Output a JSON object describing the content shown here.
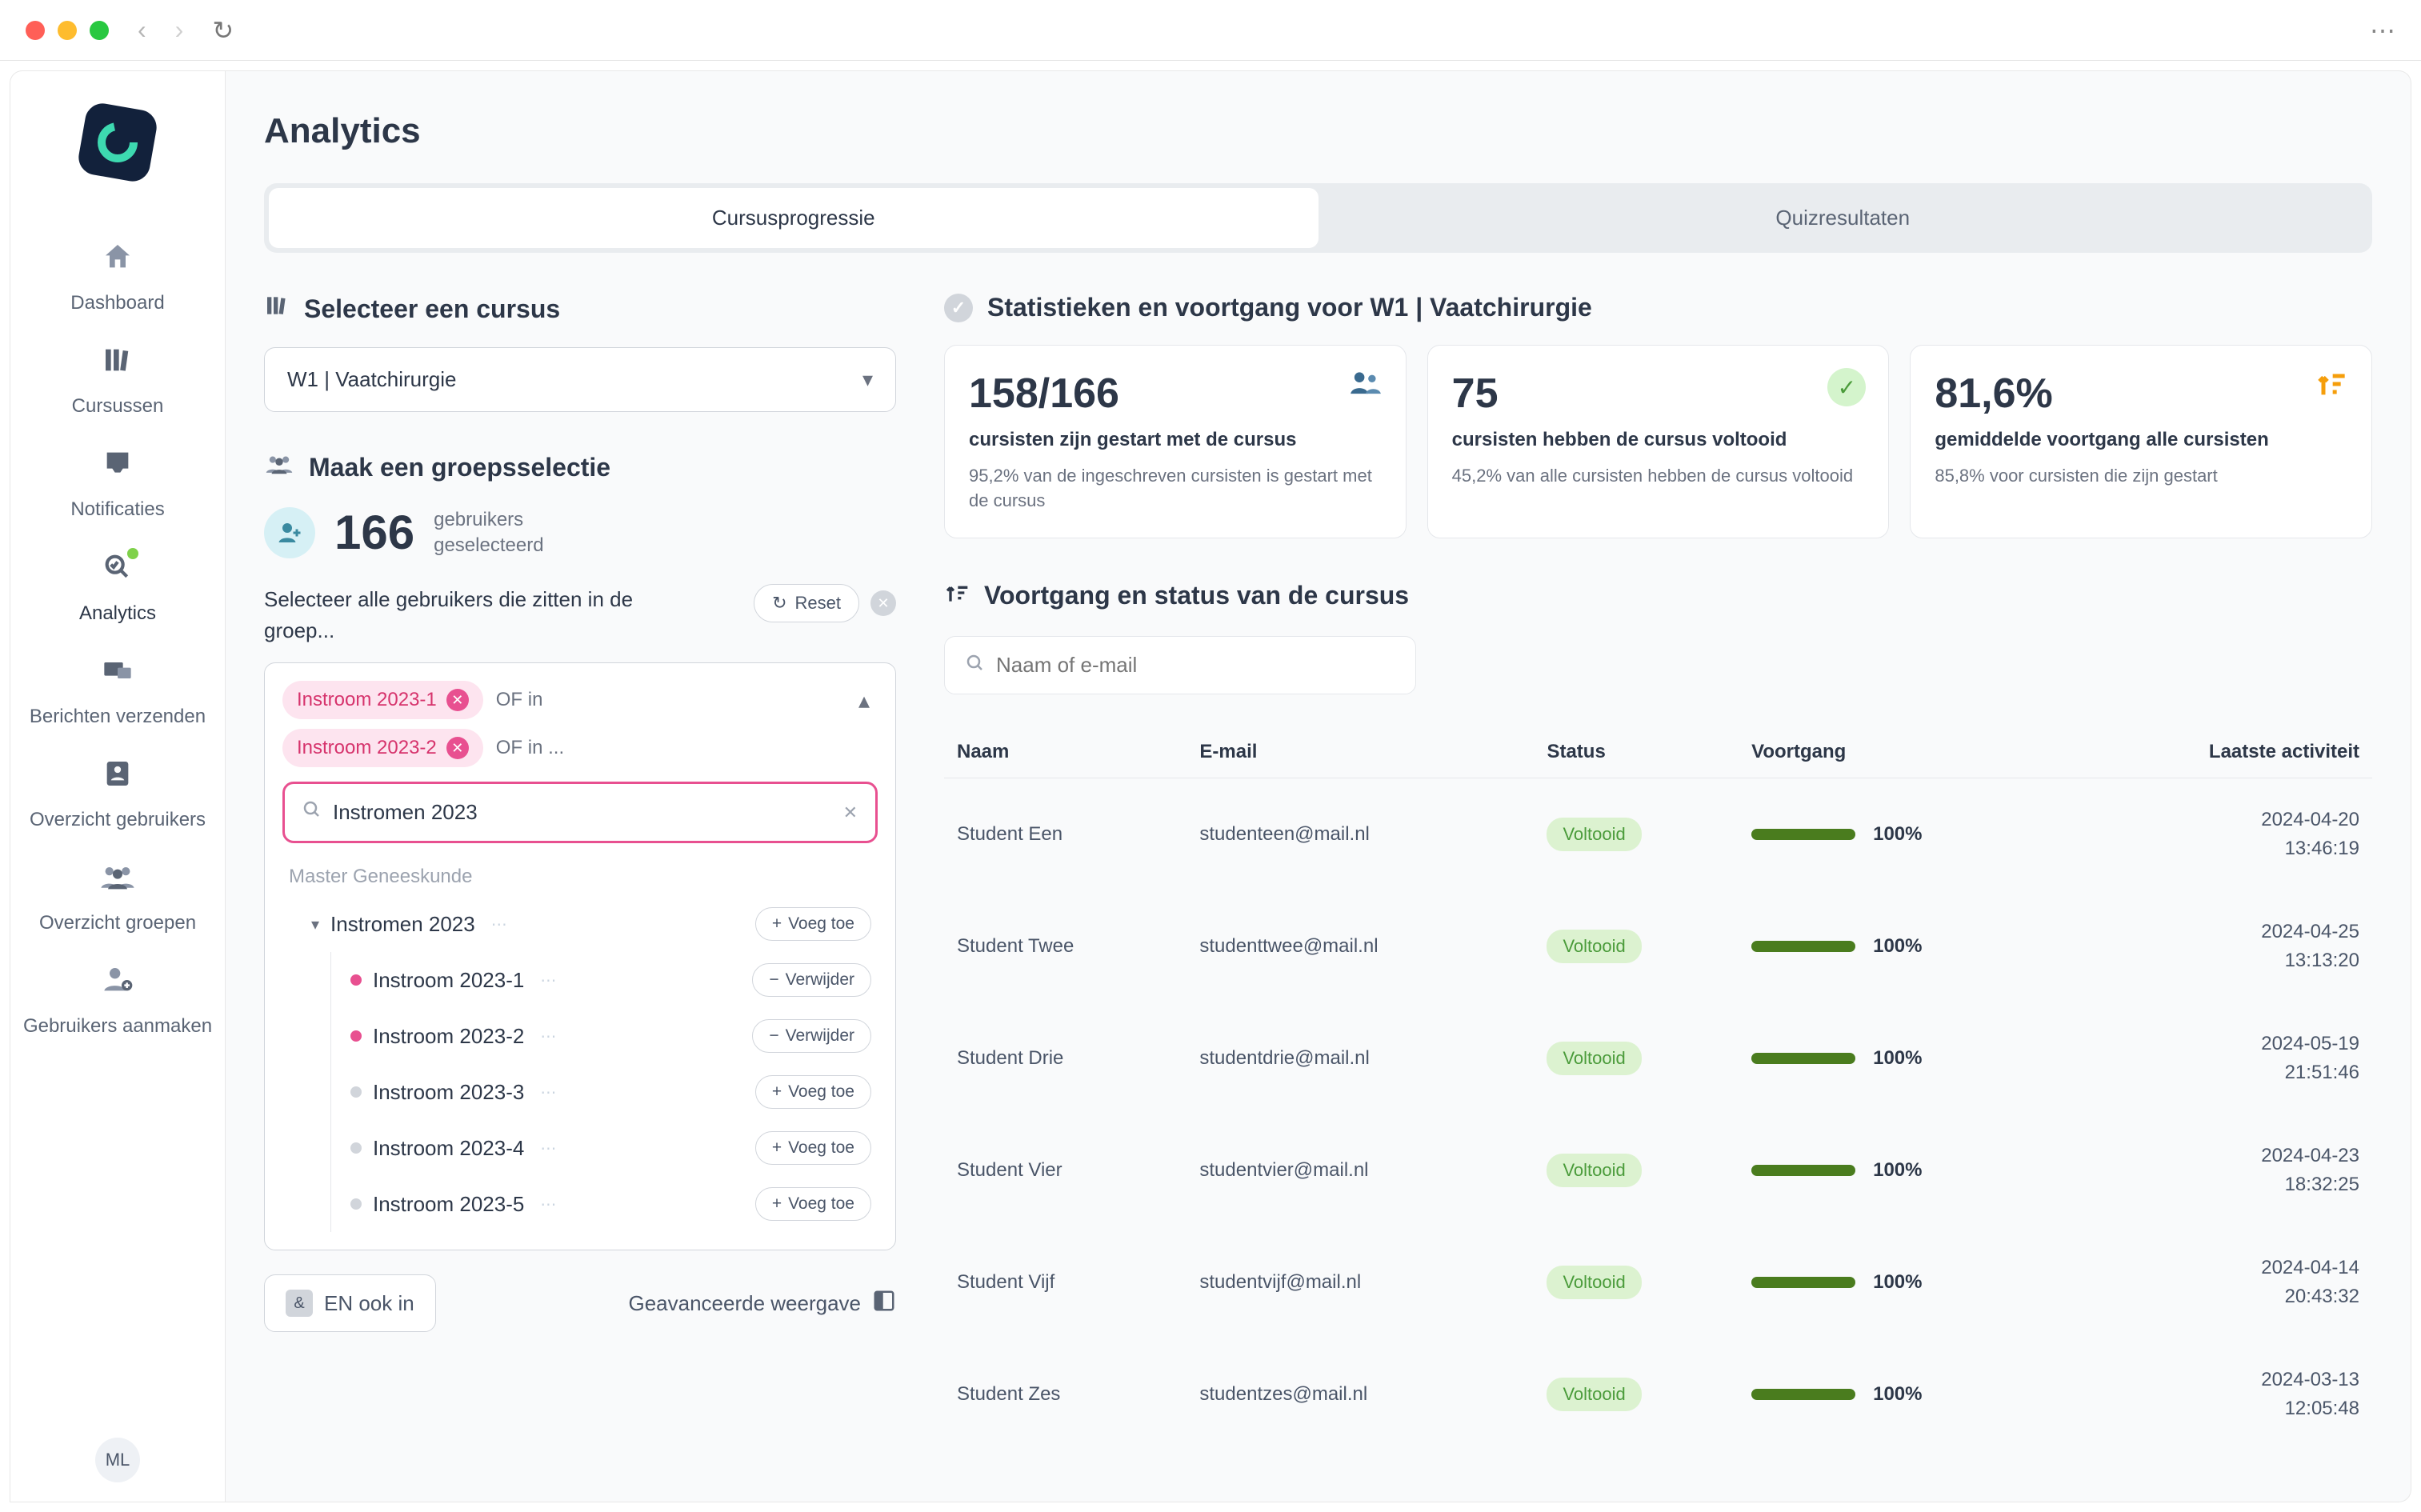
{
  "chrome": {
    "avatar": "ML"
  },
  "sidebar": {
    "items": [
      {
        "label": "Dashboard"
      },
      {
        "label": "Cursussen"
      },
      {
        "label": "Notificaties"
      },
      {
        "label": "Analytics"
      },
      {
        "label": "Berichten verzenden"
      },
      {
        "label": "Overzicht gebruikers"
      },
      {
        "label": "Overzicht groepen"
      },
      {
        "label": "Gebruikers aanmaken"
      }
    ]
  },
  "page": {
    "title": "Analytics"
  },
  "tabs": {
    "t1": "Cursusprogressie",
    "t2": "Quizresultaten"
  },
  "course_select": {
    "header": "Selecteer een cursus",
    "value": "W1 | Vaatchirurgie"
  },
  "group": {
    "header": "Maak een groepsselectie",
    "count": "166",
    "count_label1": "gebruikers",
    "count_label2": "geselecteerd",
    "filter_text": "Selecteer alle gebruikers die zitten in de groep...",
    "reset": "Reset",
    "chips": [
      {
        "label": "Instroom 2023-1",
        "suffix": "OF in"
      },
      {
        "label": "Instroom 2023-2",
        "suffix": "OF in ..."
      }
    ],
    "search_value": "Instromen 2023",
    "tree_header": "Master Geneeskunde",
    "tree_parent": "Instromen 2023",
    "tree_items": [
      {
        "label": "Instroom 2023-1",
        "active": true,
        "action": "Verwijder",
        "minus": true
      },
      {
        "label": "Instroom 2023-2",
        "active": true,
        "action": "Verwijder",
        "minus": true
      },
      {
        "label": "Instroom 2023-3",
        "active": false,
        "action": "Voeg toe",
        "minus": false
      },
      {
        "label": "Instroom 2023-4",
        "active": false,
        "action": "Voeg toe",
        "minus": false
      },
      {
        "label": "Instroom 2023-5",
        "active": false,
        "action": "Voeg toe",
        "minus": false
      }
    ],
    "parent_action": "Voeg toe",
    "and_label": "EN ook in",
    "adv_label": "Geavanceerde weergave"
  },
  "stats": {
    "header": "Statistieken en voortgang voor W1 | Vaatchirurgie",
    "cards": [
      {
        "big": "158/166",
        "title": "cursisten zijn gestart met de cursus",
        "sub": "95,2% van de ingeschreven cursisten is gestart met de cursus"
      },
      {
        "big": "75",
        "title": "cursisten hebben de cursus voltooid",
        "sub": "45,2% van alle cursisten hebben de cursus voltooid"
      },
      {
        "big": "81,6%",
        "title": "gemiddelde voortgang alle cursisten",
        "sub": "85,8% voor cursisten die zijn gestart"
      }
    ]
  },
  "progress": {
    "header": "Voortgang en status van de cursus",
    "search_placeholder": "Naam of e-mail",
    "columns": {
      "c1": "Naam",
      "c2": "E-mail",
      "c3": "Status",
      "c4": "Voortgang",
      "c5": "Laatste activiteit"
    },
    "rows": [
      {
        "name": "Student Een",
        "email": "studenteen@mail.nl",
        "status": "Voltooid",
        "prog": "100%",
        "date": "2024-04-20",
        "time": "13:46:19"
      },
      {
        "name": "Student Twee",
        "email": "studenttwee@mail.nl",
        "status": "Voltooid",
        "prog": "100%",
        "date": "2024-04-25",
        "time": "13:13:20"
      },
      {
        "name": "Student Drie",
        "email": "studentdrie@mail.nl",
        "status": "Voltooid",
        "prog": "100%",
        "date": "2024-05-19",
        "time": "21:51:46"
      },
      {
        "name": "Student Vier",
        "email": "studentvier@mail.nl",
        "status": "Voltooid",
        "prog": "100%",
        "date": "2024-04-23",
        "time": "18:32:25"
      },
      {
        "name": "Student Vijf",
        "email": "studentvijf@mail.nl",
        "status": "Voltooid",
        "prog": "100%",
        "date": "2024-04-14",
        "time": "20:43:32"
      },
      {
        "name": "Student Zes",
        "email": "studentzes@mail.nl",
        "status": "Voltooid",
        "prog": "100%",
        "date": "2024-03-13",
        "time": "12:05:48"
      }
    ]
  }
}
